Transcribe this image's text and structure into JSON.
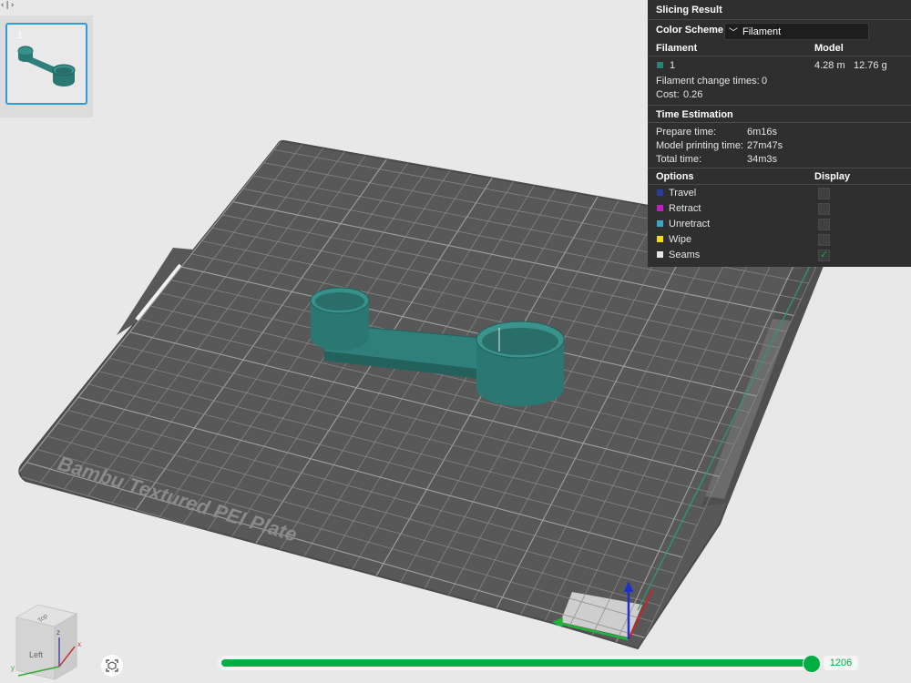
{
  "toggle": {
    "label": "‹|›"
  },
  "plate_thumbnail": {
    "index": "1"
  },
  "slicing_result": {
    "title": "Slicing Result",
    "color_scheme": {
      "label": "Color Scheme",
      "value": "Filament"
    },
    "filament_header": "Filament",
    "model_header": "Model",
    "filament_row": {
      "index": "1",
      "length": "4.28 m",
      "weight": "12.76 g",
      "color": "#2f7f7a"
    },
    "filament_change_times": {
      "label": "Filament change times:",
      "value": "0"
    },
    "cost": {
      "label": "Cost:",
      "value": "0.26"
    },
    "time_estimation": {
      "title": "Time Estimation",
      "prepare": {
        "label": "Prepare time:",
        "value": "6m16s"
      },
      "model_printing": {
        "label": "Model printing time:",
        "value": "27m47s"
      },
      "total": {
        "label": "Total time:",
        "value": "34m3s"
      }
    },
    "options": {
      "header": "Options",
      "display_header": "Display",
      "items": [
        {
          "label": "Travel",
          "color": "#2b3b9a",
          "checked": false
        },
        {
          "label": "Retract",
          "color": "#c020c0",
          "checked": false
        },
        {
          "label": "Unretract",
          "color": "#3aa7c9",
          "checked": false
        },
        {
          "label": "Wipe",
          "color": "#f0e010",
          "checked": false
        },
        {
          "label": "Seams",
          "color": "#e6e6e6",
          "checked": true
        }
      ]
    }
  },
  "build_plate": {
    "label": "Bambu Textured PEI Plate",
    "number": "01"
  },
  "nav_cube": {
    "top": "Top",
    "left": "Left",
    "axis_x": "x",
    "axis_y": "y",
    "axis_z": "z"
  },
  "layer_slider": {
    "value": "1206",
    "position": 0.98
  },
  "colors": {
    "accent": "#00ae42",
    "model": "#2f7f7a",
    "plate": "#585858"
  }
}
